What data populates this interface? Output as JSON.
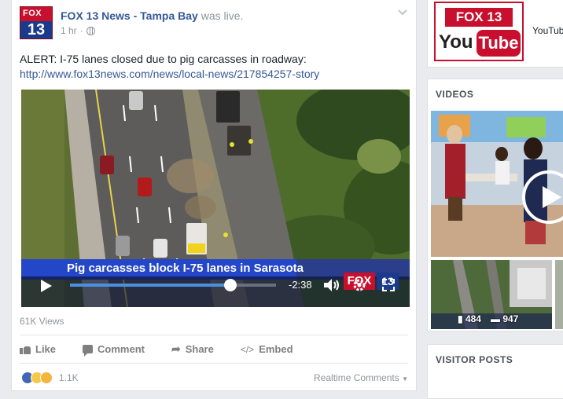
{
  "post": {
    "page_name": "FOX 13 News - Tampa Bay",
    "status_suffix": "was live.",
    "time": "1 hr",
    "avatar_top": "FOX",
    "avatar_bottom": "13",
    "text": "ALERT: I-75 lanes closed due to pig carcasses in roadway:",
    "link": "http://www.fox13news.com/news/local-news/217854257-story"
  },
  "video": {
    "lower_third": "Pig carcasses block I-75 lanes in Sarasota",
    "time_remaining": "-2:38",
    "progress_fraction": 0.78,
    "watermark_fox": "FOX",
    "watermark_num": "13"
  },
  "stats": {
    "views": "61K Views",
    "reaction_count": "1.1K",
    "realtime_comments": "Realtime Comments"
  },
  "actions": {
    "like": "Like",
    "comment": "Comment",
    "share": "Share",
    "embed": "Embed"
  },
  "sidebar": {
    "youtube_fox": "FOX 13",
    "youtube_you": "You",
    "youtube_tube": "Tube",
    "youtube_label": "YouTub",
    "videos_title": "VIDEOS",
    "thumb_likes": "484",
    "thumb_comments": "947",
    "visitor_posts_title": "VISITOR POSTS"
  },
  "colors": {
    "facebook_link": "#365899",
    "fox_red": "#c8102e",
    "fox_blue": "#1b3a8c",
    "video_bar_blue": "#2446c8"
  }
}
